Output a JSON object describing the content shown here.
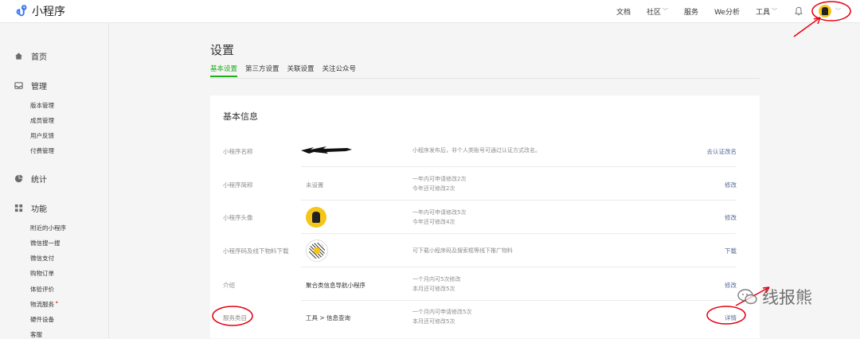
{
  "app": {
    "title": "小程序"
  },
  "topnav": {
    "items": [
      {
        "label": "文档",
        "dropdown": false
      },
      {
        "label": "社区",
        "dropdown": true
      },
      {
        "label": "服务",
        "dropdown": false
      },
      {
        "label": "We分析",
        "dropdown": false
      },
      {
        "label": "工具",
        "dropdown": true
      }
    ],
    "icons": {
      "notifications": "bell-icon",
      "account": "avatar",
      "menu": "chevron-down-icon"
    }
  },
  "sidebar": {
    "home": {
      "label": "首页",
      "icon": "home-icon"
    },
    "manage": {
      "label": "管理",
      "icon": "inbox-icon",
      "items": [
        "版本管理",
        "成员管理",
        "用户反馈",
        "付费管理"
      ]
    },
    "stats": {
      "label": "统计",
      "icon": "pie-chart-icon"
    },
    "features": {
      "label": "功能",
      "icon": "grid-icon",
      "items": [
        "附近的小程序",
        "微信搜一搜",
        "微信支付",
        "购物订单",
        "体验评价",
        "物流服务",
        "硬件设备",
        "客服"
      ],
      "badge_item_index": 5
    }
  },
  "page": {
    "title": "设置",
    "tabs": [
      {
        "label": "基本设置",
        "active": true
      },
      {
        "label": "第三方设置",
        "active": false
      },
      {
        "label": "关联设置",
        "active": false
      },
      {
        "label": "关注公众号",
        "active": false
      }
    ]
  },
  "basic_info": {
    "title": "基本信息",
    "rows": [
      {
        "label": "小程序名称",
        "value": "",
        "redacted": true,
        "hint": [
          "小程序发布后，非个人类账号可通过认证方式改名。"
        ],
        "action": "去认证改名"
      },
      {
        "label": "小程序简称",
        "value": "未设置",
        "hint": [
          "一年内可申请修改2次",
          "今年还可修改2次"
        ],
        "action": "修改"
      },
      {
        "label": "小程序头像",
        "value": "",
        "image": "app-avatar",
        "hint": [
          "一年内可申请修改5次",
          "今年还可修改4次"
        ],
        "action": "修改"
      },
      {
        "label": "小程序码及线下物料下载",
        "value": "",
        "image": "qr-code",
        "hint": [
          "可下载小程序码及搜索框等线下推广物料"
        ],
        "action": "下载"
      },
      {
        "label": "介绍",
        "value": "聚合类信息导航小程序",
        "hint": [
          "一个月内可5次修改",
          "本月还可修改5次"
        ],
        "action": "修改"
      },
      {
        "label": "服务类目",
        "value": "工具 > 信息查询",
        "hint": [
          "一个月内可申请修改5次",
          "本月还可修改5次"
        ],
        "action": "详情"
      }
    ]
  },
  "annotations": {
    "color": "#e60012"
  },
  "watermark": {
    "text": "线报熊",
    "icon": "wechat-icon"
  },
  "colors": {
    "accent": "#1aad19",
    "link": "#576b95",
    "badge": "#e64340"
  }
}
